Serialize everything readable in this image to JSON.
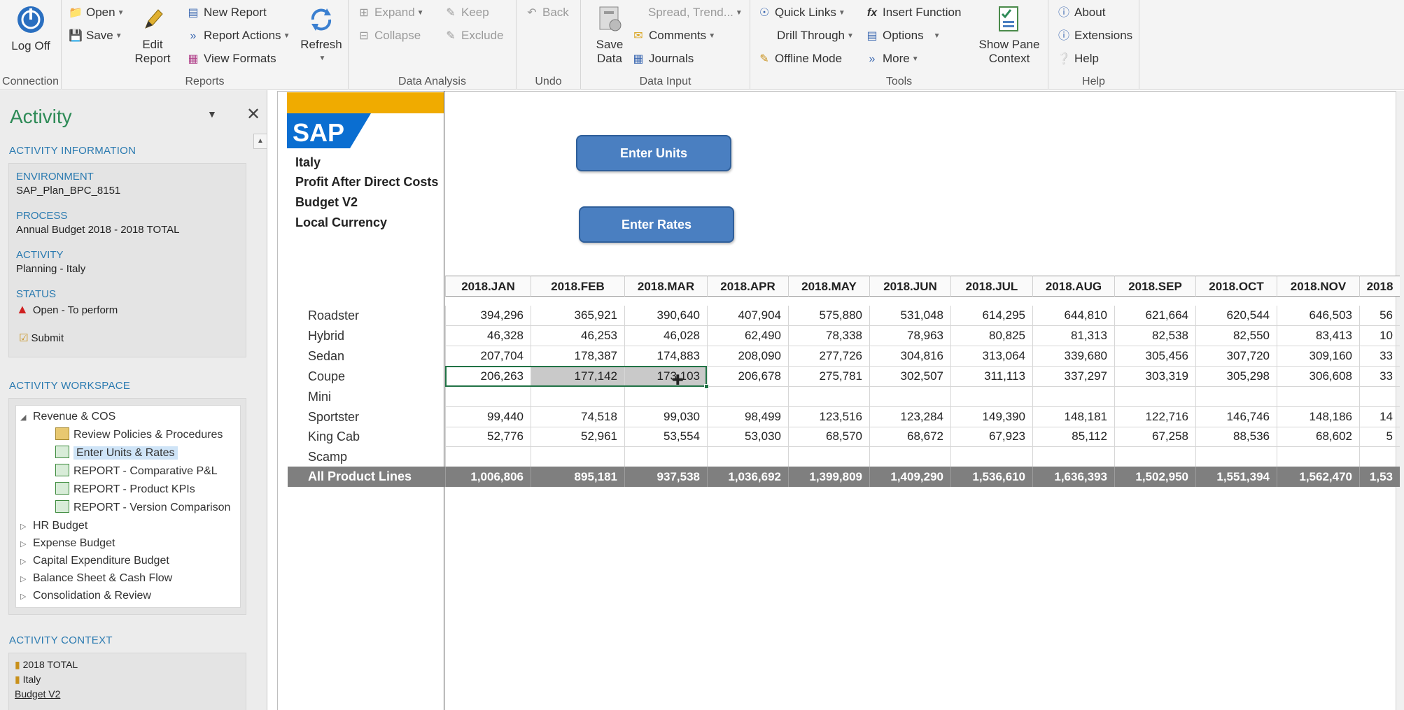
{
  "ribbon": {
    "connection": {
      "log_off": "Log Off",
      "group": "Connection"
    },
    "reports": {
      "open": "Open",
      "save": "Save",
      "edit_report": "Edit Report",
      "new_report": "New Report",
      "report_actions": "Report Actions",
      "view_formats": "View Formats",
      "refresh": "Refresh",
      "group": "Reports"
    },
    "data_analysis": {
      "expand": "Expand",
      "collapse": "Collapse",
      "keep": "Keep",
      "exclude": "Exclude",
      "group": "Data Analysis"
    },
    "undo": {
      "back": "Back",
      "group": "Undo"
    },
    "data_input": {
      "save_data": "Save Data",
      "spread_trend": "Spread, Trend...",
      "comments": "Comments",
      "journals": "Journals",
      "group": "Data Input"
    },
    "tools": {
      "quick_links": "Quick Links",
      "drill_through": "Drill Through",
      "offline_mode": "Offline Mode",
      "insert_function": "Insert Function",
      "options": "Options",
      "more": "More",
      "show_pane_context": "Show Pane Context",
      "group": "Tools"
    },
    "help": {
      "about": "About",
      "extensions": "Extensions",
      "help": "Help",
      "group": "Help"
    }
  },
  "pane": {
    "title": "Activity",
    "activity_information": "ACTIVITY INFORMATION",
    "environment_label": "ENVIRONMENT",
    "environment": "SAP_Plan_BPC_8151",
    "process_label": "PROCESS",
    "process": "Annual Budget 2018 - 2018 TOTAL",
    "activity_label": "ACTIVITY",
    "activity": "Planning - Italy",
    "status_label": "STATUS",
    "status": "Open - To perform",
    "submit": "Submit",
    "workspace_title": "ACTIVITY WORKSPACE",
    "workspace": {
      "root": "Revenue & COS",
      "children": [
        "Review Policies & Procedures",
        "Enter Units & Rates",
        "REPORT - Comparative P&L",
        "REPORT - Product KPIs",
        "REPORT - Version Comparison"
      ],
      "others": [
        "HR Budget",
        "Expense Budget",
        "Capital Expenditure Budget",
        "Balance Sheet & Cash Flow",
        "Consolidation & Review"
      ]
    },
    "context_title": "ACTIVITY CONTEXT",
    "context": [
      "2018 TOTAL",
      "Italy",
      "Budget V2"
    ]
  },
  "sheet": {
    "logo": "SAP",
    "header": [
      "Italy",
      "Profit After Direct Costs",
      "Budget V2",
      "Local Currency"
    ],
    "buttons": {
      "enter_units": "Enter Units",
      "enter_rates": "Enter Rates"
    },
    "columns": [
      "2018.JAN",
      "2018.FEB",
      "2018.MAR",
      "2018.APR",
      "2018.MAY",
      "2018.JUN",
      "2018.JUL",
      "2018.AUG",
      "2018.SEP",
      "2018.OCT",
      "2018.NOV",
      "2018"
    ],
    "rows": [
      {
        "label": "Roadster",
        "values": [
          "394,296",
          "365,921",
          "390,640",
          "407,904",
          "575,880",
          "531,048",
          "614,295",
          "644,810",
          "621,664",
          "620,544",
          "646,503",
          "56"
        ]
      },
      {
        "label": "Hybrid",
        "values": [
          "46,328",
          "46,253",
          "46,028",
          "62,490",
          "78,338",
          "78,963",
          "80,825",
          "81,313",
          "82,538",
          "82,550",
          "83,413",
          "10"
        ]
      },
      {
        "label": "Sedan",
        "values": [
          "207,704",
          "178,387",
          "174,883",
          "208,090",
          "277,726",
          "304,816",
          "313,064",
          "339,680",
          "305,456",
          "307,720",
          "309,160",
          "33"
        ]
      },
      {
        "label": "Coupe",
        "values": [
          "206,263",
          "177,142",
          "173,103",
          "206,678",
          "275,781",
          "302,507",
          "311,113",
          "337,297",
          "303,319",
          "305,298",
          "306,608",
          "33"
        ]
      },
      {
        "label": "Mini",
        "values": [
          "",
          "",
          "",
          "",
          "",
          "",
          "",
          "",
          "",
          "",
          "",
          ""
        ]
      },
      {
        "label": "Sportster",
        "values": [
          "99,440",
          "74,518",
          "99,030",
          "98,499",
          "123,516",
          "123,284",
          "149,390",
          "148,181",
          "122,716",
          "146,746",
          "148,186",
          "14"
        ]
      },
      {
        "label": "King Cab",
        "values": [
          "52,776",
          "52,961",
          "53,554",
          "53,030",
          "68,570",
          "68,672",
          "67,923",
          "85,112",
          "67,258",
          "88,536",
          "68,602",
          "5"
        ]
      },
      {
        "label": "Scamp",
        "values": [
          "",
          "",
          "",
          "",
          "",
          "",
          "",
          "",
          "",
          "",
          "",
          ""
        ]
      }
    ],
    "total": {
      "label": "All Product Lines",
      "values": [
        "1,006,806",
        "895,181",
        "937,538",
        "1,036,692",
        "1,399,809",
        "1,409,290",
        "1,536,610",
        "1,636,393",
        "1,502,950",
        "1,551,394",
        "1,562,470",
        "1,53"
      ]
    }
  },
  "colors": {
    "accent_green": "#2e8b57",
    "section_blue": "#2a7ab0",
    "button_blue": "#4a7fc1",
    "total_gray": "#7f7f7f",
    "sap_blue": "#0a6ed1",
    "sap_gold": "#f0ab00"
  }
}
